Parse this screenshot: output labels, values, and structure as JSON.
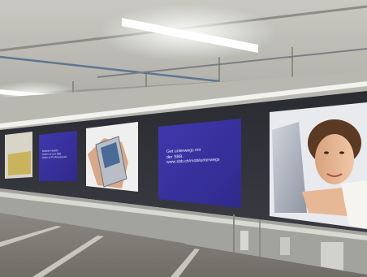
{
  "scene": {
    "subject": "advertising light boxes in a parking garage",
    "colors": {
      "ceiling": "#b7b7b0",
      "wall": "#9b9b95",
      "floor": "#7c7a72",
      "panel_blue": "#3b33a0",
      "rail": "#e8e8e4"
    }
  },
  "ads": {
    "left_panel": {
      "lines": "Mobile Health\nhome to our 586\ntests of Professionals"
    },
    "main_panel": {
      "lines": "Get unterwegs mit\nder SBB.\nwww.sbb.ch/mobilunterwegs"
    }
  }
}
